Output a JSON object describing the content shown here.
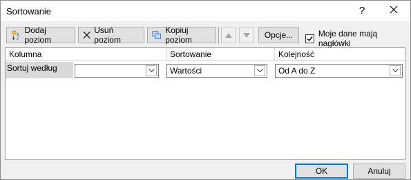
{
  "window": {
    "title": "Sortowanie",
    "help_label": "?"
  },
  "toolbar": {
    "add_level": "Dodaj poziom",
    "delete_level": "Usuń poziom",
    "copy_level": "Kopiuj poziom",
    "options": "Opcje...",
    "header_checkbox_label": "Moje dane mają nagłówki",
    "header_checkbox_checked": true
  },
  "grid": {
    "columns": [
      "Kolumna",
      "Sortowanie",
      "Kolejność"
    ],
    "rows": [
      {
        "label": "Sortuj według",
        "column_value": "",
        "sort_on": "Wartości",
        "order": "Od A do Z"
      }
    ]
  },
  "footer": {
    "ok": "OK",
    "cancel": "Anuluj"
  },
  "colors": {
    "accent": "#0078d7",
    "row_label_bg": "#d9d9d9"
  }
}
